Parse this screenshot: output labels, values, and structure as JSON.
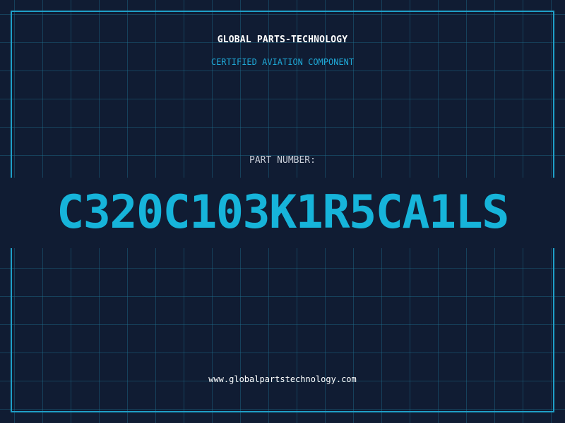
{
  "header": {
    "company": "GLOBAL PARTS-TECHNOLOGY",
    "tagline": "CERTIFIED AVIATION COMPONENT"
  },
  "part": {
    "label": "PART NUMBER:",
    "number": "C320C103K1R5CA1LS"
  },
  "footer": {
    "website": "www.globalpartstechnology.com"
  },
  "colors": {
    "background": "#101c33",
    "grid": "#1e6e8c",
    "accent": "#1fa0c8",
    "part_number": "#16b4da",
    "text_primary": "#ffffff",
    "text_muted": "#c9ced8"
  }
}
